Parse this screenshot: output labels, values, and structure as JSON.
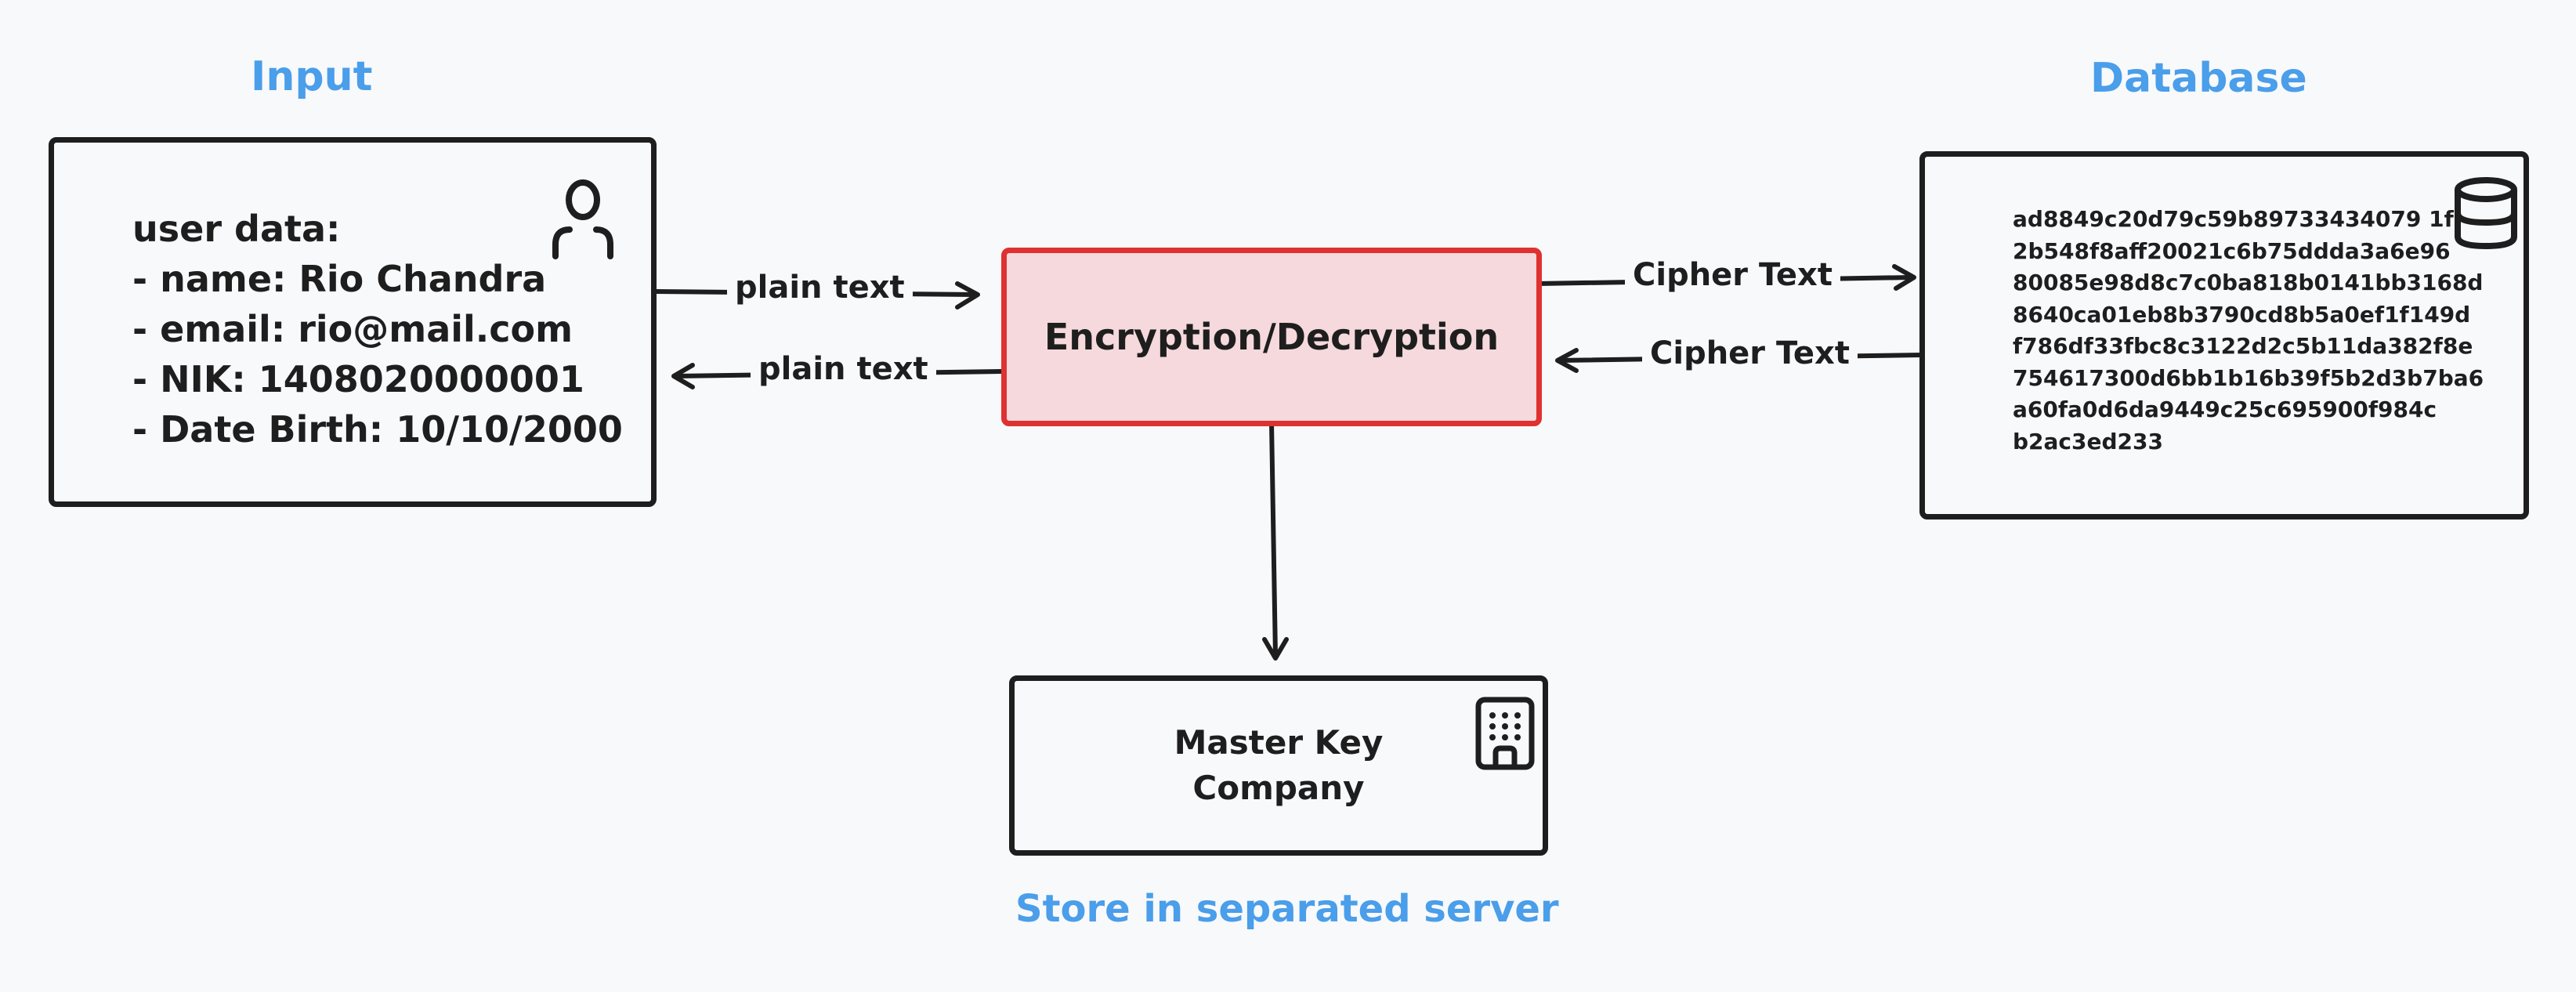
{
  "titles": {
    "input": "Input",
    "database": "Database",
    "footer": "Store in separated server"
  },
  "input_box": {
    "lines": [
      "user data:",
      "- name: Rio Chandra",
      "- email: rio@mail.com",
      "- NIK: 1408020000001",
      "- Date Birth: 10/10/2000"
    ],
    "icon": "user-icon"
  },
  "encryption_box": {
    "label": "Encryption/Decryption",
    "fill": "#f5d9dc",
    "stroke": "#e03131"
  },
  "database_box": {
    "lines": [
      "ad8849c20d79c59b89733434079 1f",
      "2b548f8aff20021c6b75ddda3a6e96",
      "80085e98d8c7c0ba818b0141bb3168d",
      "8640ca01eb8b3790cd8b5a0ef1f149d",
      "f786df33fbc8c3122d2c5b11da382f8e",
      "754617300d6bb1b16b39f5b2d3b7ba6",
      "a60fa0d6da9449c25c695900f984c",
      "b2ac3ed233"
    ],
    "icon": "database-icon"
  },
  "master_key_box": {
    "lines": [
      "Master Key",
      "Company"
    ],
    "icon": "building-icon"
  },
  "edges": {
    "input_to_enc": "plain text",
    "enc_to_input": "plain text",
    "enc_to_db": "Cipher Text",
    "db_to_enc": "Cipher Text"
  },
  "colors": {
    "accent": "#4a9eea",
    "stroke": "#1e1e1e",
    "background": "#f8f9fb"
  }
}
